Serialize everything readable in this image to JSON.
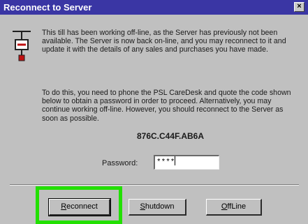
{
  "window": {
    "title": "Reconnect to Server",
    "close_glyph": "×"
  },
  "icon": {
    "name": "network-plug-icon"
  },
  "message": {
    "paragraph1": "This till has been working off-line, as the Server has previously not been available. The Server is now back on-line, and you may reconnect to it and update it with the details of any sales and purchases you have made.",
    "paragraph2": "To do this, you need to phone the PSL CareDesk and quote the code shown below to obtain a password in order to proceed. Alternatively, you may continue working off-line. However, you should reconnect to the Server as soon as possible."
  },
  "code": "876C.C44F.AB6A",
  "password": {
    "label": "Password:",
    "masked_value": "****"
  },
  "buttons": {
    "reconnect_first": "R",
    "reconnect_rest": "econnect",
    "shutdown_first": "S",
    "shutdown_rest": "hutdown",
    "offline_first": "O",
    "offline_rest": "ffLine"
  },
  "colors": {
    "titlebar": "#3a36a4",
    "dialog_bg": "#c0c0c0",
    "highlight": "#22e000"
  }
}
